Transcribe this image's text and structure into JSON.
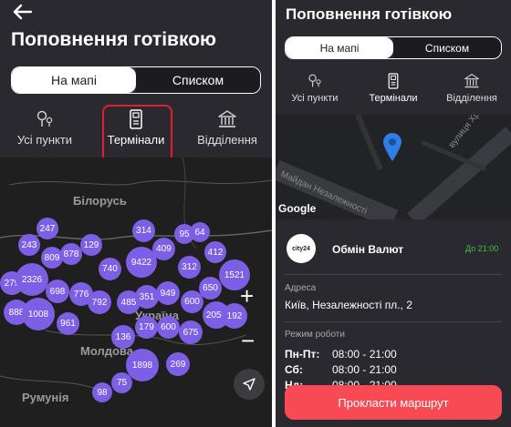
{
  "title": "Поповнення готівкою",
  "view_toggle": {
    "map": "На мапі",
    "list": "Списком"
  },
  "categories": [
    {
      "label": "Усі пункти",
      "icon": "location-pin-icon"
    },
    {
      "label": "Термінали",
      "icon": "terminal-icon"
    },
    {
      "label": "Відділення",
      "icon": "bank-icon"
    }
  ],
  "map_labels": {
    "belarus": "Білорусь",
    "ukraine": "Україна",
    "moldova": "Молдова",
    "romania": "Румунія"
  },
  "clusters": [
    "247",
    "243",
    "809",
    "878",
    "129",
    "314",
    "95",
    "64",
    "409",
    "412",
    "740",
    "9422",
    "312",
    "1521",
    "279",
    "2326",
    "698",
    "776",
    "792",
    "485",
    "351",
    "949",
    "600",
    "650",
    "888",
    "1008",
    "961",
    "179",
    "600",
    "2056",
    "192",
    "136",
    "675",
    "1898",
    "269",
    "75",
    "98"
  ],
  "zoom": {
    "in": "+",
    "out": "−"
  },
  "detail": {
    "streets": [
      "Майдан Незалежності",
      "вулиця Хр"
    ],
    "google": "Google",
    "logo_text": "city24",
    "place_name": "Обмін Валют",
    "status": "До 21:00",
    "address_label": "Адреса",
    "address": "Київ, Незалежності пл., 2",
    "hours_label": "Режим роботи",
    "hours": [
      {
        "day": "Пн-Пт:",
        "time": "08:00 - 21:00"
      },
      {
        "day": "Сб:",
        "time": "08:00 - 21:00"
      },
      {
        "day": "Нд:",
        "time": "08:00 - 21:00"
      }
    ],
    "route_button": "Прокласти маршрут"
  },
  "colors": {
    "background": "#2a292f",
    "cluster": "#7c5fe4",
    "highlight": "#e01e2d",
    "cta": "#f74a55",
    "open_status": "#3cc24a"
  }
}
